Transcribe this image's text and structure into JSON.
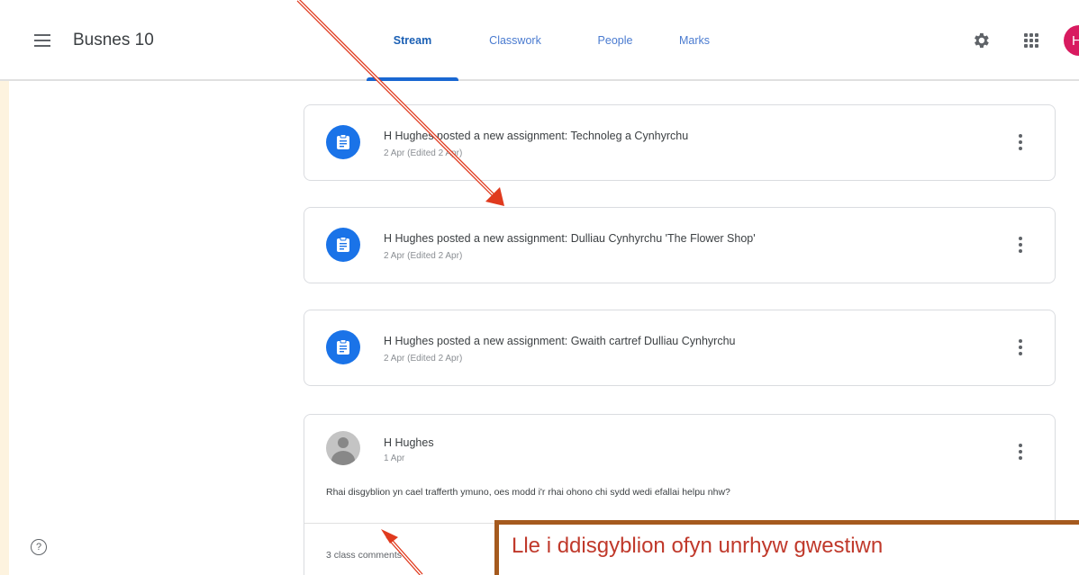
{
  "header": {
    "class_title": "Busnes 10",
    "tabs": [
      {
        "label": "Stream",
        "active": true
      },
      {
        "label": "Classwork",
        "active": false
      },
      {
        "label": "People",
        "active": false
      },
      {
        "label": "Marks",
        "active": false
      }
    ],
    "avatar_initial": "H"
  },
  "stream": {
    "posts": [
      {
        "title": "H Hughes posted a new assignment: Technoleg a Cynhyrchu",
        "date": "2 Apr (Edited 2 Apr)"
      },
      {
        "title": "H Hughes posted a new assignment: Dulliau Cynhyrchu 'The Flower Shop'",
        "date": "2 Apr (Edited 2 Apr)"
      },
      {
        "title": "H Hughes posted a new assignment: Gwaith cartref Dulliau Cynhyrchu",
        "date": "2 Apr (Edited 2 Apr)"
      }
    ],
    "announcement": {
      "author": "H Hughes",
      "date": "1 Apr",
      "message": "Rhai disgyblion yn cael trafferth ymuno, oes modd i'r rhai ohono chi sydd wedi efallai helpu nhw?",
      "comments": "3 class comments"
    }
  },
  "help_glyph": "?",
  "callout": {
    "text": "Lle i ddisgyblion ofyn unrhyw gwestiwn"
  },
  "colors": {
    "accent_blue": "#1a73e8",
    "avatar_pink": "#d81b60",
    "arrow_red": "#e03a1e",
    "callout_border": "#a55a1e",
    "callout_text": "#c0392b"
  },
  "icons": {
    "menu": "menu-icon",
    "settings": "gear-icon",
    "apps": "apps-grid-icon",
    "assignment": "assignment-icon",
    "more": "more-vert-icon",
    "help": "help-icon"
  }
}
